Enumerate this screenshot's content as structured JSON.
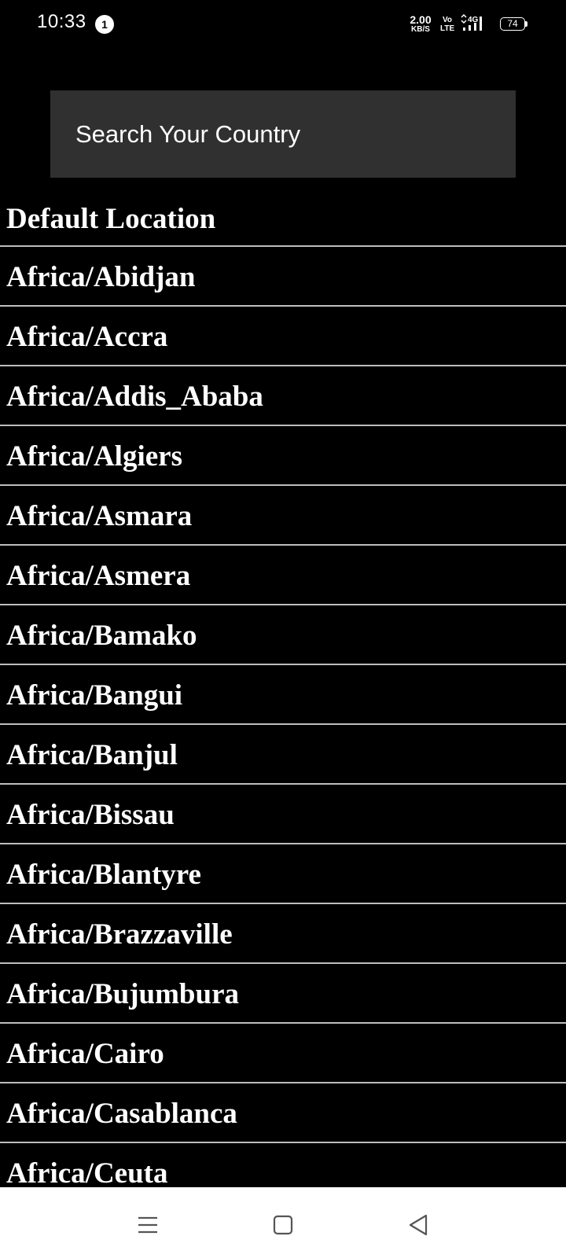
{
  "status_bar": {
    "time": "10:33",
    "notification_count": "1",
    "net_speed_value": "2.00",
    "net_speed_unit": "KB/S",
    "volte_top": "Vo",
    "volte_bottom": "LTE",
    "network_type": "4G",
    "battery_level": "74"
  },
  "search": {
    "placeholder": "Search Your Country"
  },
  "timezones": [
    "Default Location",
    "Africa/Abidjan",
    "Africa/Accra",
    "Africa/Addis_Ababa",
    "Africa/Algiers",
    "Africa/Asmara",
    "Africa/Asmera",
    "Africa/Bamako",
    "Africa/Bangui",
    "Africa/Banjul",
    "Africa/Bissau",
    "Africa/Blantyre",
    "Africa/Brazzaville",
    "Africa/Bujumbura",
    "Africa/Cairo",
    "Africa/Casablanca",
    "Africa/Ceuta"
  ],
  "nav_bar": {
    "menu_icon": "menu-icon",
    "home_icon": "square-home-icon",
    "back_icon": "triangle-back-icon"
  },
  "colors": {
    "background": "#000000",
    "search_bg": "#303030",
    "divider": "#bdbdbd",
    "nav_bg": "#ffffff"
  }
}
